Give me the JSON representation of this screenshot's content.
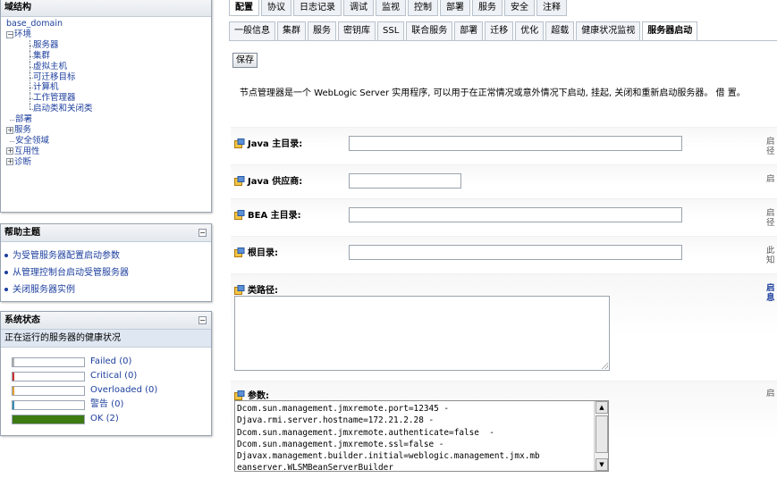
{
  "tree": {
    "title": "域结构",
    "root": "base_domain",
    "env": "环境",
    "env_children": [
      "服务器",
      "集群",
      "虚拟主机",
      "可迁移目标",
      "计算机",
      "工作管理器",
      "启动类和关闭类"
    ],
    "items": [
      "部署",
      "服务",
      "安全领域",
      "互用性",
      "诊断"
    ]
  },
  "help": {
    "title": "帮助主题",
    "links": [
      "为受管服务器配置启动参数",
      "从管理控制台启动受管服务器",
      "关闭服务器实例"
    ]
  },
  "system_status": {
    "title": "系统状态",
    "subtitle": "正在运行的服务器的健康状况",
    "rows": [
      {
        "label": "Failed (0)",
        "value": 0,
        "color": "#b0b0b0"
      },
      {
        "label": "Critical (0)",
        "value": 0,
        "color": "#cc3333"
      },
      {
        "label": "Overloaded (0)",
        "value": 0,
        "color": "#e0a030"
      },
      {
        "label": "警告 (0)",
        "value": 0,
        "color": "#3a8fb0"
      },
      {
        "label": "OK (2)",
        "value": 2,
        "color": "#3d7a12"
      }
    ]
  },
  "top_tabs": [
    "配置",
    "协议",
    "日志记录",
    "调试",
    "监视",
    "控制",
    "部署",
    "服务",
    "安全",
    "注释"
  ],
  "sub_tabs": [
    "一般信息",
    "集群",
    "服务",
    "密钥库",
    "SSL",
    "联合服务",
    "部署",
    "迁移",
    "优化",
    "超载",
    "健康状况监视",
    "服务器启动"
  ],
  "save_label": "保存",
  "description": "节点管理器是一个 WebLogic Server 实用程序, 可以用于在正常情况或意外情况下启动, 挂起, 关闭和重新启动服务器。 借 置。",
  "fields": {
    "java_home": {
      "label": "Java 主目录:",
      "value": "",
      "hint": "启 径"
    },
    "java_vendor": {
      "label": "Java 供应商:",
      "value": "",
      "hint": "启"
    },
    "bea_home": {
      "label": "BEA 主目录:",
      "value": "",
      "hint": "启 径"
    },
    "root_dir": {
      "label": "根目录:",
      "value": "",
      "hint": "此 知"
    },
    "classpath": {
      "label": "类路径:",
      "value": "",
      "hint": "启 息"
    },
    "arguments": {
      "label": "参数:",
      "hint": "启",
      "lines": [
        "Dcom.sun.management.jmxremote.port=12345 -",
        "Djava.rmi.server.hostname=172.21.2.28 -",
        "Dcom.sun.management.jmxremote.authenticate=false  -",
        "Dcom.sun.management.jmxremote.ssl=false -",
        "Djavax.management.builder.initial=weblogic.management.jmx.mb",
        "eanserver.WLSMBeanServerBuilder"
      ]
    }
  },
  "icons": {
    "tree_expand": "plus-box-icon",
    "tree_collapse": "minus-box-icon",
    "field": "field-help-icon"
  }
}
